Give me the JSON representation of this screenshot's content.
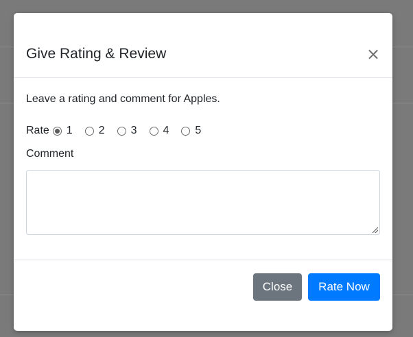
{
  "modal": {
    "title": "Give Rating & Review",
    "close_symbol": "×",
    "intro_text": "Leave a rating and comment for Apples.",
    "rate_label": "Rate",
    "rating_options": [
      "1",
      "2",
      "3",
      "4",
      "5"
    ],
    "selected_rating": "1",
    "comment_label": "Comment",
    "comment_value": "",
    "buttons": {
      "close_label": "Close",
      "rate_label": "Rate Now"
    }
  },
  "colors": {
    "primary": "#007bff",
    "secondary": "#6c757d",
    "backdrop": "#7a7a7a"
  }
}
